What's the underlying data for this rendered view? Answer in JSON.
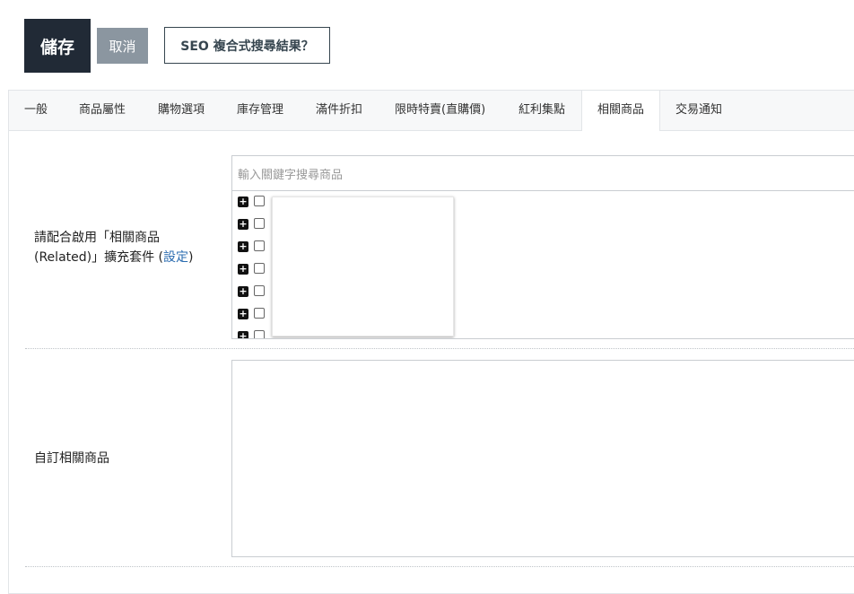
{
  "toolbar": {
    "save_label": "儲存",
    "cancel_label": "取消",
    "seo_label": "SEO 複合式搜尋結果？"
  },
  "tabs": [
    {
      "label": "一般"
    },
    {
      "label": "商品屬性"
    },
    {
      "label": "購物選項"
    },
    {
      "label": "庫存管理"
    },
    {
      "label": "滿件折扣"
    },
    {
      "label": "限時特賣(直購價)"
    },
    {
      "label": "紅利集點"
    },
    {
      "label": "相關商品"
    },
    {
      "label": "交易通知"
    }
  ],
  "related": {
    "label_line1": "請配合啟用「相關商品",
    "label_line2_prefix": "(Related)」擴充套件 (",
    "settings_link": "設定",
    "label_line2_suffix": ")",
    "search_placeholder": "輸入關鍵字搜尋商品"
  },
  "custom": {
    "label": "自訂相關商品"
  }
}
